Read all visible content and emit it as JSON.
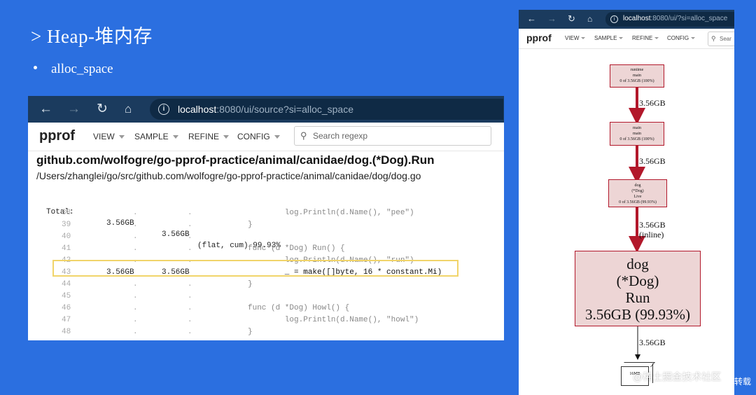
{
  "slide": {
    "title": "> Heap-堆内存",
    "bullet": "alloc_space"
  },
  "left_browser": {
    "url_host": "localhost",
    "url_rest": ":8080/ui/source?si=alloc_space",
    "logo": "pprof",
    "menus": [
      "VIEW",
      "SAMPLE",
      "REFINE",
      "CONFIG"
    ],
    "search_placeholder": "Search regexp",
    "source_title": "github.com/wolfogre/go-pprof-practice/animal/canidae/dog.(*Dog).Run",
    "source_path": "/Users/zhanglei/go/src/github.com/wolfogre/go-pprof-practice/animal/canidae/dog/dog.go",
    "total": {
      "label": "Total:",
      "flat": "3.56GB",
      "cum": "3.56GB",
      "note": "(flat, cum) 99.93%"
    },
    "lines": [
      {
        "no": "38",
        "flat": ".",
        "cum": ".",
        "code": "        log.Println(d.Name(), \"pee\")"
      },
      {
        "no": "39",
        "flat": ".",
        "cum": ".",
        "code": "}"
      },
      {
        "no": "40",
        "flat": ".",
        "cum": ".",
        "code": ""
      },
      {
        "no": "41",
        "flat": ".",
        "cum": ".",
        "code": "func (d *Dog) Run() {"
      },
      {
        "no": "42",
        "flat": ".",
        "cum": ".",
        "code": "        log.Println(d.Name(), \"run\")"
      },
      {
        "no": "43",
        "flat": "3.56GB",
        "cum": "3.56GB",
        "code": "        _ = make([]byte, 16 * constant.Mi)"
      },
      {
        "no": "44",
        "flat": ".",
        "cum": ".",
        "code": "}"
      },
      {
        "no": "45",
        "flat": ".",
        "cum": ".",
        "code": ""
      },
      {
        "no": "46",
        "flat": ".",
        "cum": ".",
        "code": "func (d *Dog) Howl() {"
      },
      {
        "no": "47",
        "flat": ".",
        "cum": ".",
        "code": "        log.Println(d.Name(), \"howl\")"
      },
      {
        "no": "48",
        "flat": ".",
        "cum": ".",
        "code": "}"
      }
    ]
  },
  "right_browser": {
    "url_host": "localhost",
    "url_rest": ":8080/ui/?si=alloc_space",
    "logo": "pprof",
    "menus": [
      "VIEW",
      "SAMPLE",
      "REFINE",
      "CONFIG"
    ],
    "search_placeholder": "Sear",
    "nodes": [
      {
        "lines": [
          "runtime",
          "main",
          "0 of 3.56GB (100%)"
        ]
      },
      {
        "lines": [
          "main",
          "main",
          "0 of 3.56GB (100%)"
        ]
      },
      {
        "lines": [
          "dog",
          "(*Dog)",
          "Live",
          "0 of 3.56GB (99.93%)"
        ]
      },
      {
        "lines": [
          "dog",
          "(*Dog)",
          "Run",
          "3.56GB (99.93%)"
        ]
      }
    ],
    "edge_labels": [
      "3.56GB",
      "3.56GB",
      "3.56GB",
      "(inline)",
      "3.56GB"
    ],
    "leaf_label": "16MB"
  },
  "watermark": "@稀土掘金技术社区",
  "watermark_edge": "转载"
}
